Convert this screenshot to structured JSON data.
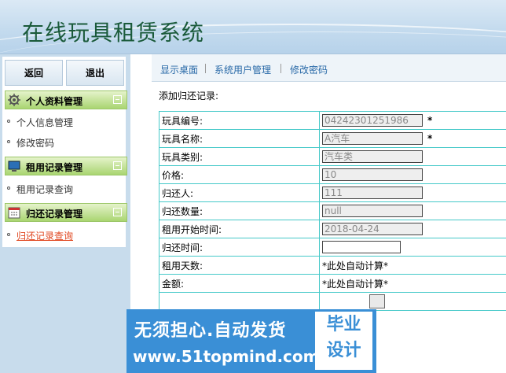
{
  "header": {
    "title": "在线玩具租赁系统"
  },
  "sidebar": {
    "back_label": "返回",
    "logout_label": "退出",
    "sections": [
      {
        "title": "个人资料管理",
        "icon": "gear-icon",
        "items": [
          "个人信息管理",
          "修改密码"
        ]
      },
      {
        "title": "租用记录管理",
        "icon": "monitor-icon",
        "items": [
          "租用记录查询"
        ]
      },
      {
        "title": "归还记录管理",
        "icon": "calendar-icon",
        "items": [
          "归还记录查询"
        ]
      }
    ]
  },
  "tabs": [
    "显示桌面",
    "系统用户管理",
    "修改密码"
  ],
  "main": {
    "heading": "添加归还记录:",
    "rows": [
      {
        "label": "玩具编号:",
        "value": "04242301251986",
        "required": "*"
      },
      {
        "label": "玩具名称:",
        "value": "A汽车",
        "required": "*"
      },
      {
        "label": "玩具类别:",
        "value": "汽车类"
      },
      {
        "label": "价格:",
        "value": "10"
      },
      {
        "label": "归还人:",
        "value": "111"
      },
      {
        "label": "归还数量:",
        "value": "null"
      },
      {
        "label": "租用开始时间:",
        "value": "2018-04-24"
      },
      {
        "label": "归还时间:",
        "value": ""
      },
      {
        "label": "租用天数:",
        "text": "*此处自动计算*"
      },
      {
        "label": "金额:",
        "text": "*此处自动计算*"
      }
    ]
  },
  "watermark": {
    "line1": "无须担心.自动发货",
    "line2": "www.51topmind.com",
    "box1": "毕业",
    "box2": "设计"
  },
  "colors": {
    "accent_green": "#a9d571",
    "link_blue": "#2a6aa8",
    "table_border": "#46c9c9",
    "watermark_blue": "#3a8fd6"
  }
}
